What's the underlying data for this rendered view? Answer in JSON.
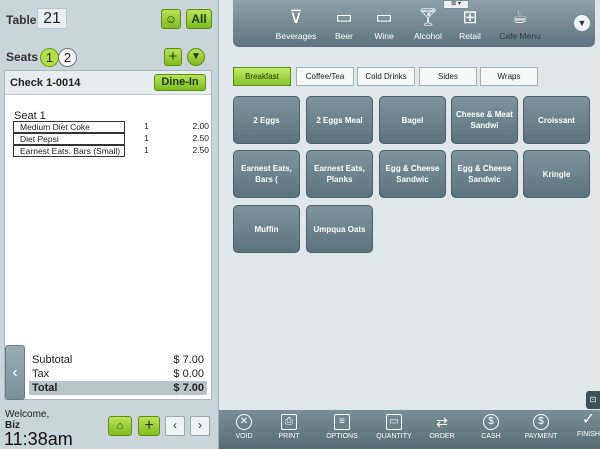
{
  "left": {
    "table_label": "Table",
    "table_number": "21",
    "all_label": "All",
    "seats_label": "Seats",
    "seats": [
      "1",
      "2"
    ],
    "add_seat": "+",
    "check_title": "Check  1-0014",
    "dine_in_label": "Dine-In",
    "seat_heading": "Seat 1",
    "items": [
      {
        "name": "Medium Diet Coke",
        "qty": "1",
        "price": "2.00"
      },
      {
        "name": "Diet Pepsi",
        "qty": "1",
        "price": "2.50"
      },
      {
        "name": "Earnest Eats. Bars (Small)",
        "qty": "1",
        "price": "2.50"
      }
    ],
    "totals": {
      "subtotal_label": "Subtotal",
      "subtotal_value": "$ 7.00",
      "tax_label": "Tax",
      "tax_value": "$ 0.00",
      "total_label": "Total",
      "total_value": "$ 7.00"
    },
    "welcome": "Welcome,",
    "user": "Biz",
    "time": "11:38am",
    "add_label": "+"
  },
  "categories": [
    {
      "label": "Beverages",
      "icon": "glass-icon"
    },
    {
      "label": "Beer",
      "icon": "folder-icon"
    },
    {
      "label": "Wine",
      "icon": "folder-icon"
    },
    {
      "label": "Alcohol",
      "icon": "cocktail-icon"
    },
    {
      "label": "Retail",
      "icon": "gift-icon"
    },
    {
      "label": "Cafe Menu",
      "icon": "coffee-cup-icon"
    }
  ],
  "tabs": [
    "Breakfast",
    "Coffee/Tea",
    "Cold Drinks",
    "Sides",
    "Wraps"
  ],
  "products": [
    "2 Eggs",
    "2 Eggs Meal",
    "Bagel",
    "Cheese & Meat Sandwi",
    "Croissant",
    "Earnest Eats, Bars (",
    "Earnest Eats, Planks",
    "Egg & Cheese Sandwic",
    "Egg & Cheese Sandwic",
    "Kringle",
    "Muffin",
    "Umpqua Oats"
  ],
  "actions": [
    "VOID",
    "PRINT",
    "OPTIONS",
    "QUANTITY",
    "ORDER",
    "CASH",
    "PAYMENT"
  ],
  "finish_label": "FINISH",
  "colors": {
    "accent_green": "#86c32a",
    "tile": "#6b8088",
    "bar": "#6a7e85"
  }
}
